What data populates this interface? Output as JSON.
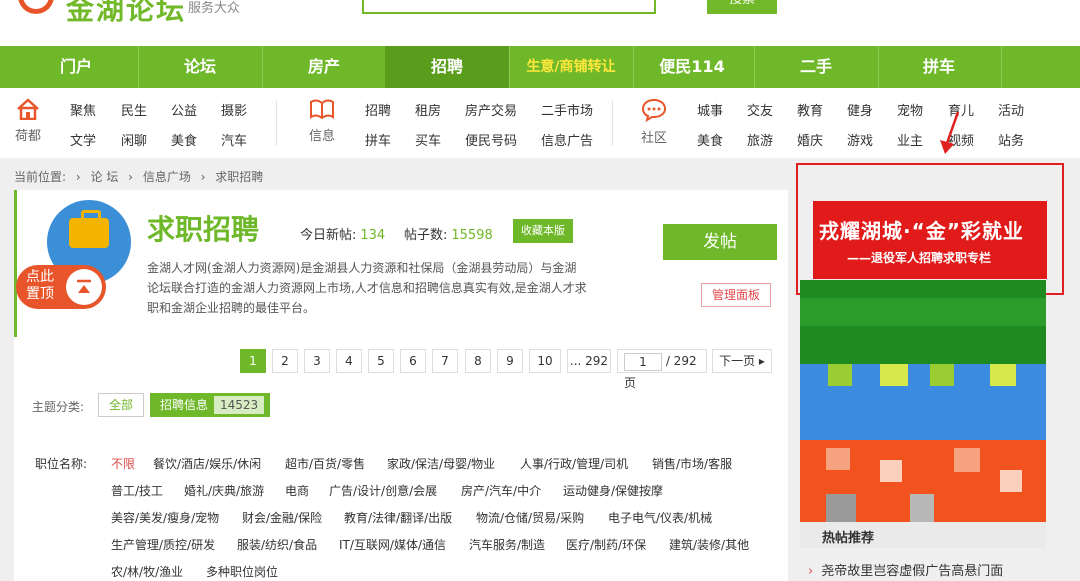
{
  "header": {
    "logo_text": "金湖论坛",
    "slogan": "服务大众",
    "search_button": "搜索"
  },
  "main_nav": [
    "门户",
    "论坛",
    "房产",
    "招聘",
    "生意/商铺转让",
    "便民114",
    "二手",
    "拼车"
  ],
  "sub_nav": {
    "home_label": "荷都",
    "home_links": [
      "聚焦",
      "民生",
      "公益",
      "摄影",
      "文学",
      "闲聊",
      "美食",
      "汽车"
    ],
    "info_label": "信息",
    "info_links": [
      "招聘",
      "租房",
      "房产交易",
      "二手市场",
      "拼车",
      "买车",
      "便民号码",
      "信息广告"
    ],
    "community_label": "社区",
    "community_links": [
      "城事",
      "交友",
      "教育",
      "健身",
      "宠物",
      "育儿",
      "活动",
      "美食",
      "旅游",
      "婚庆",
      "游戏",
      "业主",
      "视频",
      "站务"
    ]
  },
  "breadcrumb": [
    "当前位置:",
    "论 坛",
    "信息广场",
    "求职招聘"
  ],
  "board": {
    "title": "求职招聘",
    "today_label": "今日新帖:",
    "today_value": "134",
    "posts_label": "帖子数:",
    "posts_value": "15598",
    "fav_button": "收藏本版",
    "post_button": "发帖",
    "admin_button": "管理面板",
    "description": "金湖人才网(金湖人力资源网)是金湖县人力资源和社保局（金湖县劳动局）与金湖论坛联合打造的金湖人力资源网上市场,人才信息和招聘信息真实有效,是金湖人才求职和金湖企业招聘的最佳平台。",
    "float_top_label": "点此置顶"
  },
  "pagination": {
    "pages": [
      "1",
      "2",
      "3",
      "4",
      "5",
      "6",
      "7",
      "8",
      "9",
      "10",
      "... 292"
    ],
    "current": "1",
    "input_value": "1",
    "total_label": "/ 292 页",
    "next_label": "下一页"
  },
  "categories": {
    "label": "主题分类:",
    "all": "全部",
    "jobs_label": "招聘信息",
    "jobs_count": "14523"
  },
  "job_filter": {
    "label": "职位名称:",
    "rows": [
      [
        "不限",
        "餐饮/酒店/娱乐/休闲",
        "超市/百货/零售",
        "家政/保洁/母婴/物业",
        "人事/行政/管理/司机",
        "销售/市场/客服"
      ],
      [
        "普工/技工",
        "婚礼/庆典/旅游",
        "电商",
        "广告/设计/创意/会展",
        "房产/汽车/中介",
        "运动健身/保健按摩"
      ],
      [
        "美容/美发/瘦身/宠物",
        "财会/金融/保险",
        "教育/法律/翻译/出版",
        "物流/仓储/贸易/采购",
        "电子电气/仪表/机械"
      ],
      [
        "生产管理/质控/研发",
        "服装/纺织/食品",
        "IT/互联网/媒体/通信",
        "汽车服务/制造",
        "医疗/制药/环保",
        "建筑/装修/其他"
      ],
      [
        "农/林/牧/渔业",
        "多种职位岗位"
      ]
    ]
  },
  "sidebar": {
    "ad_line1": "戎耀湖城·“金”彩就业",
    "ad_line2": "——退役军人招聘求职专栏",
    "hot_title": "热帖推荐",
    "hot_item": "尧帝故里岂容虚假广告高悬门面"
  },
  "colors": {
    "brand_green": "#6fb82a",
    "accent_red": "#e11a1a",
    "orange": "#e8552a"
  }
}
